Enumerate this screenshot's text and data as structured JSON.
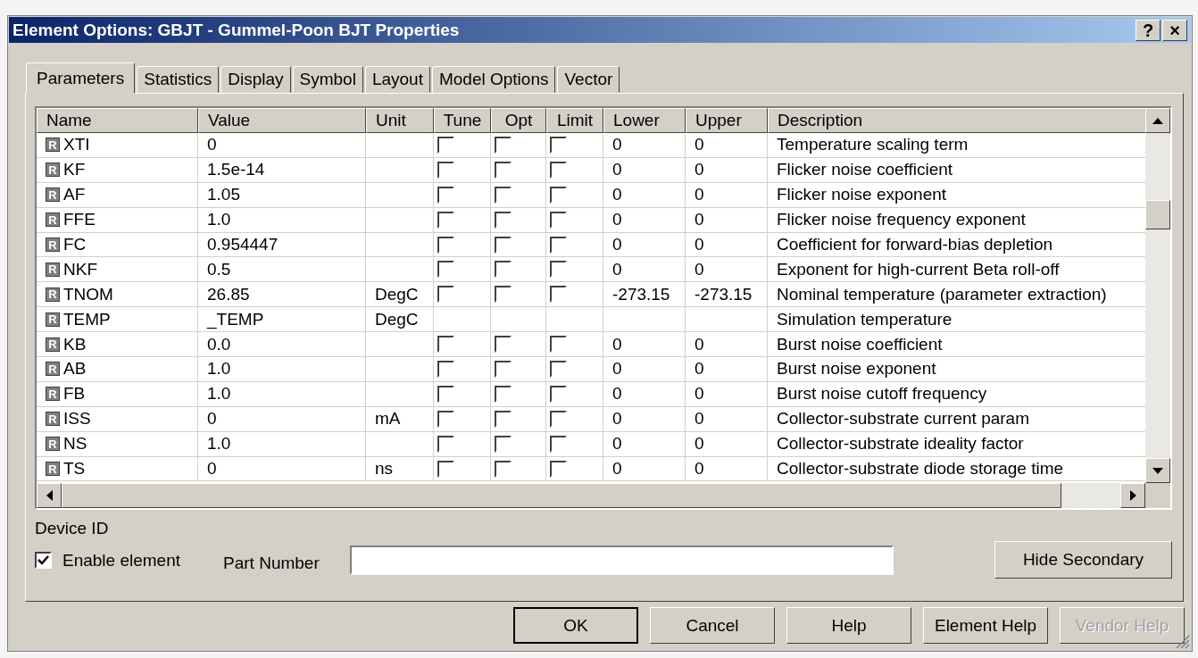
{
  "window": {
    "title": "Element Options: GBJT - Gummel-Poon BJT Properties",
    "help_button": "?",
    "close_button": "×"
  },
  "tabs": [
    {
      "label": "Parameters",
      "selected": true
    },
    {
      "label": "Statistics",
      "selected": false
    },
    {
      "label": "Display",
      "selected": false
    },
    {
      "label": "Symbol",
      "selected": false
    },
    {
      "label": "Layout",
      "selected": false
    },
    {
      "label": "Model Options",
      "selected": false
    },
    {
      "label": "Vector",
      "selected": false
    }
  ],
  "table": {
    "columns": [
      "Name",
      "Value",
      "Unit",
      "Tune",
      "Opt",
      "Limit",
      "Lower",
      "Upper",
      "Description"
    ],
    "rows": [
      {
        "kind": "param",
        "badge": "R",
        "name": "XTI",
        "value": "0",
        "unit": "",
        "tune": false,
        "opt": false,
        "limit": false,
        "lower": "0",
        "upper": "0",
        "description": "Temperature scaling term"
      },
      {
        "kind": "param",
        "badge": "R",
        "name": "KF",
        "value": "1.5e-14",
        "unit": "",
        "tune": false,
        "opt": false,
        "limit": false,
        "lower": "0",
        "upper": "0",
        "description": "Flicker noise coefficient"
      },
      {
        "kind": "param",
        "badge": "R",
        "name": "AF",
        "value": "1.05",
        "unit": "",
        "tune": false,
        "opt": false,
        "limit": false,
        "lower": "0",
        "upper": "0",
        "description": "Flicker noise exponent"
      },
      {
        "kind": "param",
        "badge": "R",
        "name": "FFE",
        "value": "1.0",
        "unit": "",
        "tune": false,
        "opt": false,
        "limit": false,
        "lower": "0",
        "upper": "0",
        "description": "Flicker noise frequency exponent"
      },
      {
        "kind": "param",
        "badge": "R",
        "name": "FC",
        "value": "0.954447",
        "unit": "",
        "tune": false,
        "opt": false,
        "limit": false,
        "lower": "0",
        "upper": "0",
        "description": "Coefficient for forward-bias depletion"
      },
      {
        "kind": "param",
        "badge": "R",
        "name": "NKF",
        "value": "0.5",
        "unit": "",
        "tune": false,
        "opt": false,
        "limit": false,
        "lower": "0",
        "upper": "0",
        "description": "Exponent for high-current Beta roll-off"
      },
      {
        "kind": "param",
        "badge": "R",
        "name": "TNOM",
        "value": "26.85",
        "unit": "DegC",
        "tune": false,
        "opt": false,
        "limit": false,
        "lower": "-273.15",
        "upper": "-273.15",
        "description": "Nominal temperature (parameter extraction)"
      },
      {
        "kind": "fixed",
        "badge": "R",
        "name": "TEMP",
        "value": "_TEMP",
        "unit": "DegC",
        "description": "Simulation temperature"
      },
      {
        "kind": "param",
        "badge": "R",
        "name": "KB",
        "value": "0.0",
        "unit": "",
        "tune": false,
        "opt": false,
        "limit": false,
        "lower": "0",
        "upper": "0",
        "description": "Burst noise coefficient"
      },
      {
        "kind": "param",
        "badge": "R",
        "name": "AB",
        "value": "1.0",
        "unit": "",
        "tune": false,
        "opt": false,
        "limit": false,
        "lower": "0",
        "upper": "0",
        "description": "Burst noise exponent"
      },
      {
        "kind": "param",
        "badge": "R",
        "name": "FB",
        "value": "1.0",
        "unit": "",
        "tune": false,
        "opt": false,
        "limit": false,
        "lower": "0",
        "upper": "0",
        "description": "Burst noise cutoff frequency"
      },
      {
        "kind": "param",
        "badge": "R",
        "name": "ISS",
        "value": "0",
        "unit": "mA",
        "tune": false,
        "opt": false,
        "limit": false,
        "lower": "0",
        "upper": "0",
        "description": "Collector-substrate current param"
      },
      {
        "kind": "param",
        "badge": "R",
        "name": "NS",
        "value": "1.0",
        "unit": "",
        "tune": false,
        "opt": false,
        "limit": false,
        "lower": "0",
        "upper": "0",
        "description": "Collector-substrate ideality factor"
      },
      {
        "kind": "param",
        "badge": "R",
        "name": "TS",
        "value": "0",
        "unit": "ns",
        "tune": false,
        "opt": false,
        "limit": false,
        "lower": "0",
        "upper": "0",
        "description": "Collector-substrate diode storage time"
      }
    ]
  },
  "device_id": {
    "label": "Device ID",
    "enable_element": {
      "label": "Enable element",
      "checked": true
    },
    "part_number": {
      "label": "Part Number"
    },
    "hide_secondary": "Hide Secondary"
  },
  "buttons": [
    {
      "label": "OK",
      "disabled": false
    },
    {
      "label": "Cancel",
      "disabled": false
    },
    {
      "label": "Help",
      "disabled": false
    },
    {
      "label": "Element Help",
      "disabled": false
    },
    {
      "label": "Vendor Help",
      "disabled": true
    }
  ]
}
